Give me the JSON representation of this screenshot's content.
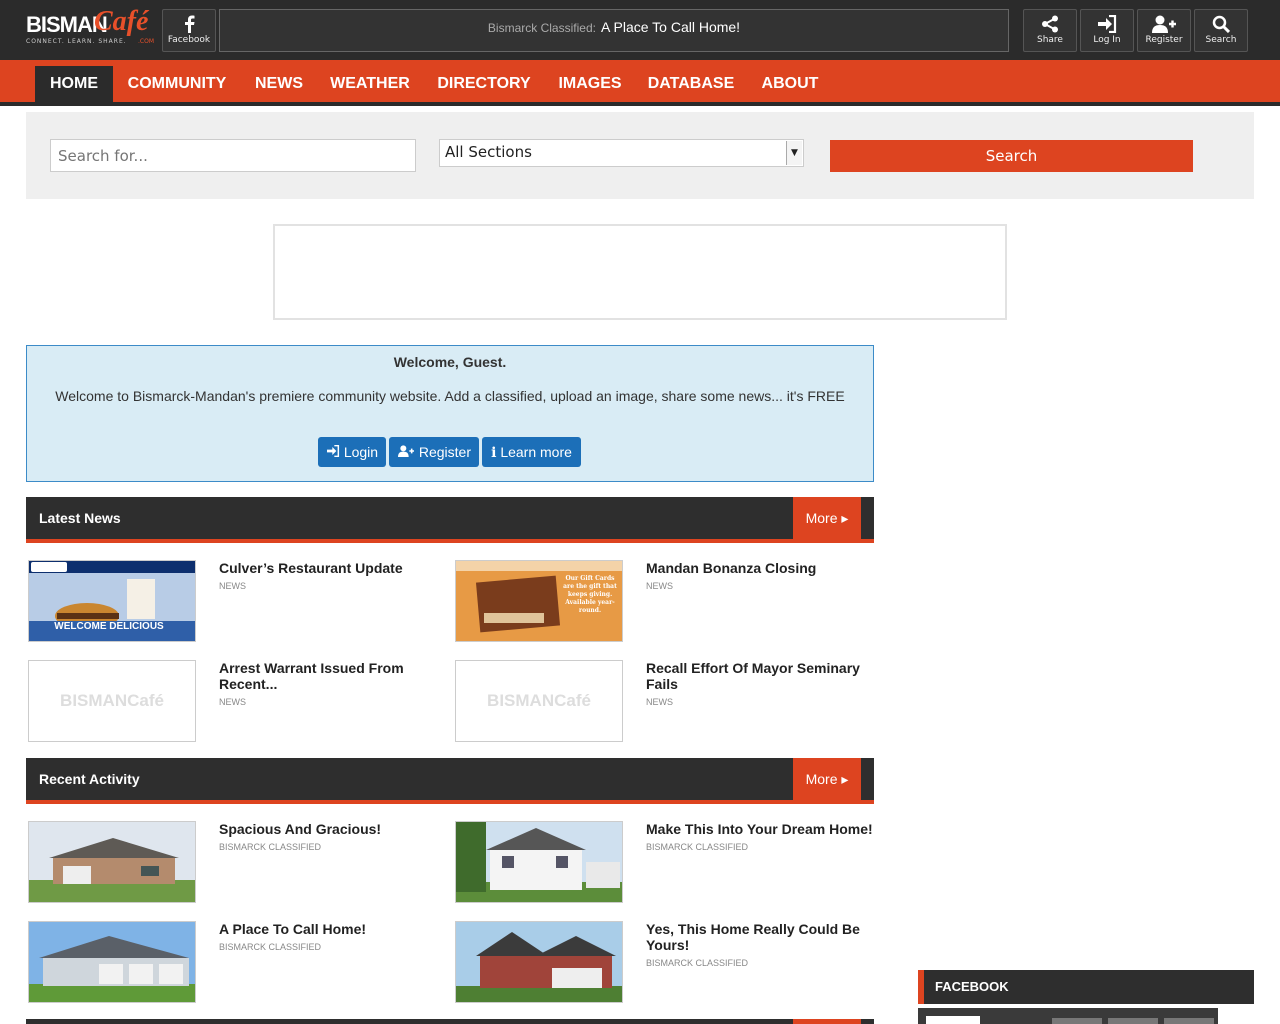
{
  "header": {
    "logo_main": "BISMAN",
    "logo_accent": "Café",
    "logo_tagline": "CONNECT. LEARN. SHARE.",
    "logo_com": ".COM",
    "facebook_label": "Facebook",
    "ticker_key": "Bismarck Classified:",
    "ticker_value": "A Place To Call Home!",
    "share_label": "Share",
    "login_label": "Log In",
    "register_label": "Register",
    "search_label": "Search"
  },
  "nav": {
    "items": [
      {
        "label": "HOME"
      },
      {
        "label": "COMMUNITY"
      },
      {
        "label": "NEWS"
      },
      {
        "label": "WEATHER"
      },
      {
        "label": "DIRECTORY"
      },
      {
        "label": "IMAGES"
      },
      {
        "label": "DATABASE"
      },
      {
        "label": "ABOUT"
      }
    ]
  },
  "search": {
    "placeholder": "Search for...",
    "section_selected": "All Sections",
    "button_label": "Search"
  },
  "welcome": {
    "heading": "Welcome, Guest.",
    "text": "Welcome to Bismarck-Mandan's premiere community website. Add a classified, upload an image, share some news... it's FREE",
    "login_label": "Login",
    "register_label": "Register",
    "learn_label": "Learn more"
  },
  "latest_news": {
    "title": "Latest News",
    "more_label": "More",
    "items": [
      {
        "title": "Culver’s Restaurant Update",
        "category": "NEWS",
        "thumb_text": "WELCOME DELICIOUS"
      },
      {
        "title": "Mandan Bonanza Closing",
        "category": "NEWS",
        "thumb_text": "Our Gift Cards are the gift that keeps giving. Available year-round."
      },
      {
        "title": "Arrest Warrant Issued From Recent...",
        "category": "NEWS",
        "thumb_text": "BISMANCafé"
      },
      {
        "title": "Recall Effort Of Mayor Seminary Fails",
        "category": "NEWS",
        "thumb_text": "BISMANCafé"
      }
    ]
  },
  "recent_activity": {
    "title": "Recent Activity",
    "more_label": "More",
    "items": [
      {
        "title": "Spacious And Gracious!",
        "category": "BISMARCK CLASSIFIED"
      },
      {
        "title": "Make This Into Your Dream Home!",
        "category": "BISMARCK CLASSIFIED"
      },
      {
        "title": "A Place To Call Home!",
        "category": "BISMARCK CLASSIFIED"
      },
      {
        "title": "Yes, This Home Really Could Be Yours!",
        "category": "BISMARCK CLASSIFIED"
      }
    ]
  },
  "sidebar": {
    "facebook_title": "FACEBOOK"
  },
  "colors": {
    "accent": "#dd4420",
    "dark": "#2b2b2b",
    "welcome_bg": "#d9ecf5",
    "button_blue": "#1c6fb8"
  }
}
